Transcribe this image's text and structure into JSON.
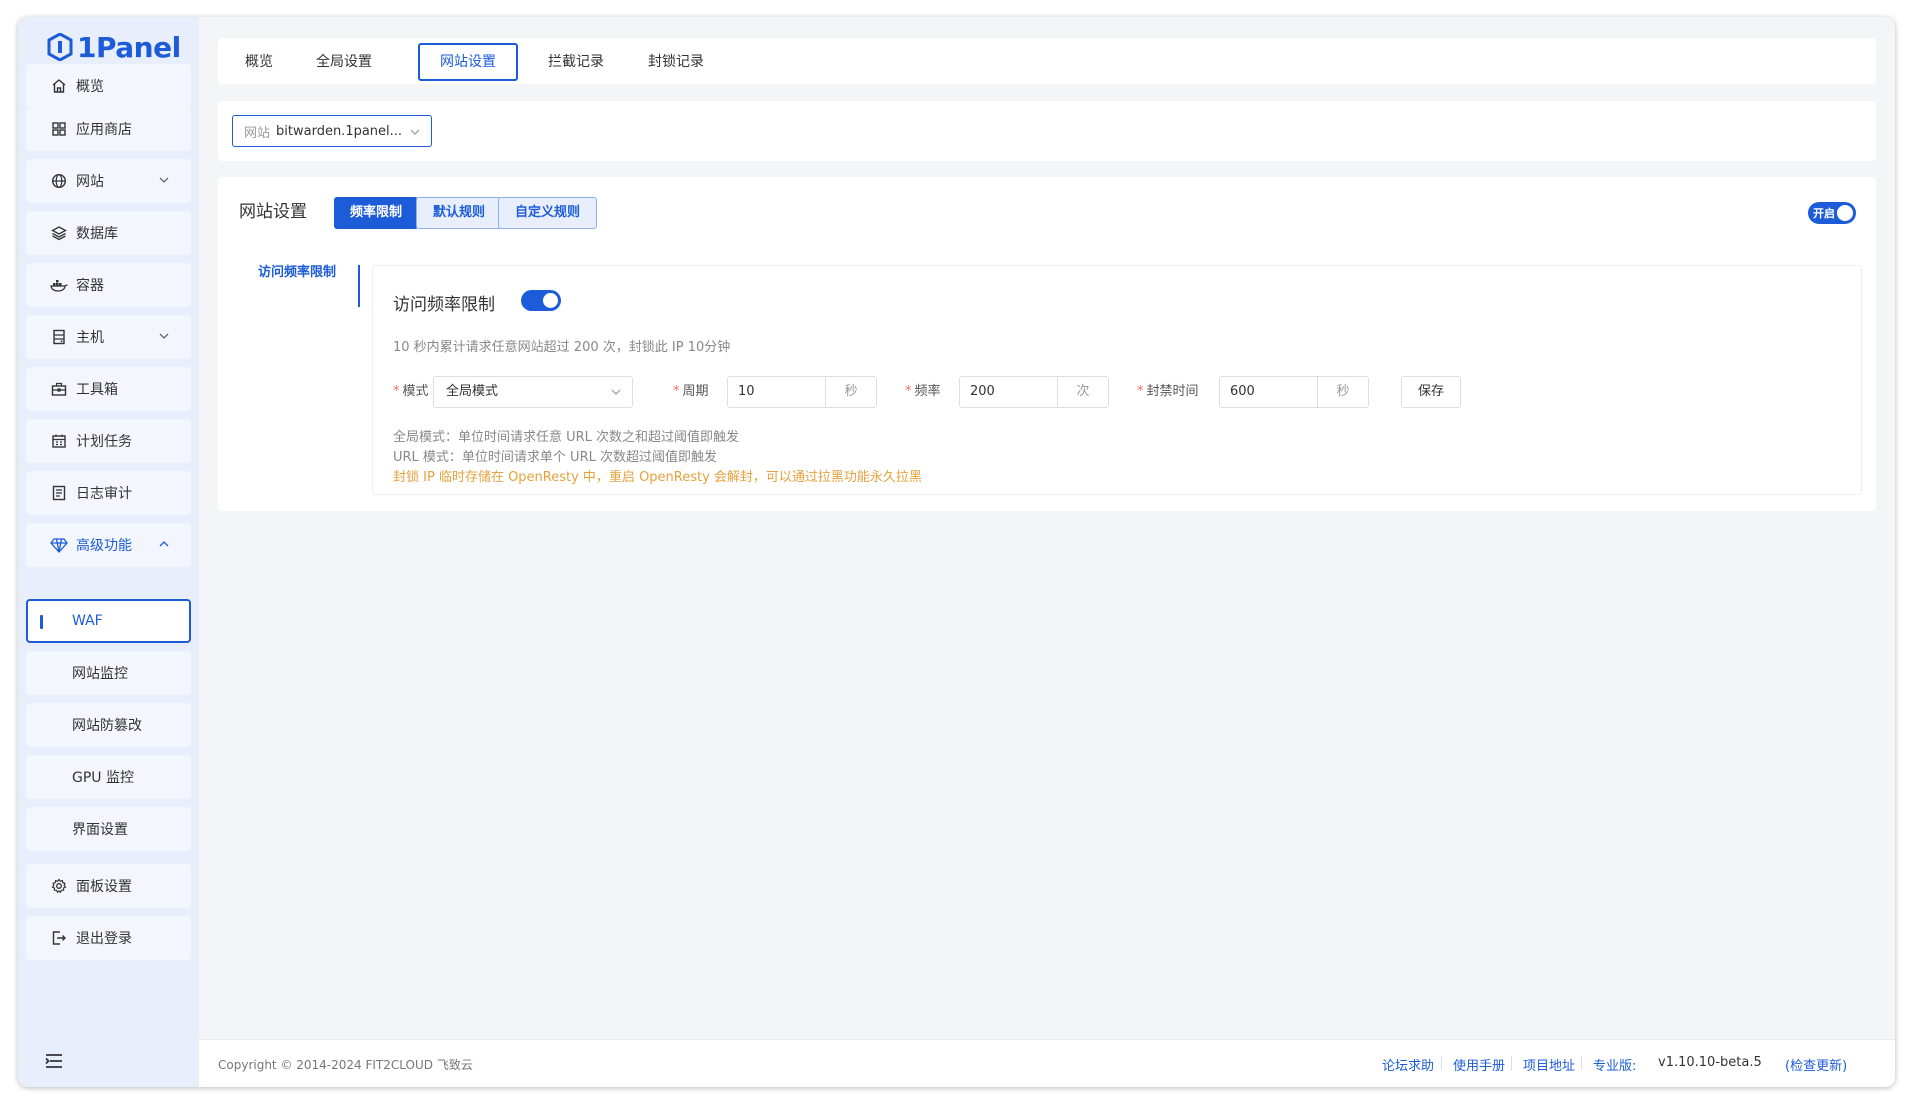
{
  "app": {
    "logo_text": "1Panel"
  },
  "sidebar": {
    "items": [
      {
        "label": "概览",
        "icon": "home-icon"
      },
      {
        "label": "应用商店",
        "icon": "grid-icon"
      },
      {
        "label": "网站",
        "icon": "globe-icon"
      },
      {
        "label": "数据库",
        "icon": "layers-icon"
      },
      {
        "label": "容器",
        "icon": "docker-icon"
      },
      {
        "label": "主机",
        "icon": "server-icon"
      },
      {
        "label": "工具箱",
        "icon": "toolbox-icon"
      },
      {
        "label": "计划任务",
        "icon": "calendar-icon"
      },
      {
        "label": "日志审计",
        "icon": "log-icon"
      },
      {
        "label": "高级功能",
        "icon": "diamond-icon"
      },
      {
        "label": "WAF"
      },
      {
        "label": "网站监控"
      },
      {
        "label": "网站防篡改"
      },
      {
        "label": "GPU 监控"
      },
      {
        "label": "界面设置"
      },
      {
        "label": "面板设置",
        "icon": "gear-icon"
      },
      {
        "label": "退出登录",
        "icon": "logout-icon"
      }
    ]
  },
  "tabs": [
    "概览",
    "全局设置",
    "网站设置",
    "拦截记录",
    "封锁记录"
  ],
  "site_select": {
    "prefix": "网站",
    "value": "bitwarden.1panel..."
  },
  "panel": {
    "title": "网站设置",
    "tabs": [
      "频率限制",
      "默认规则",
      "自定义规则"
    ],
    "enable_label": "开启",
    "side_tab": "访问频率限制",
    "rate_title": "访问频率限制",
    "description": "10 秒内累计请求任意网站超过 200 次，封锁此 IP 10分钟",
    "form": {
      "mode_label": "模式",
      "mode_value": "全局模式",
      "period_label": "周期",
      "period_value": "10",
      "period_unit": "秒",
      "freq_label": "频率",
      "freq_value": "200",
      "freq_unit": "次",
      "ban_label": "封禁时间",
      "ban_value": "600",
      "ban_unit": "秒",
      "save": "保存",
      "required_mark": "*"
    },
    "notes": [
      "全局模式：单位时间请求任意 URL 次数之和超过阈值即触发",
      "URL 模式：单位时间请求单个 URL 次数超过阈值即触发",
      "封锁 IP 临时存储在 OpenResty 中，重启 OpenResty 会解封，可以通过拉黑功能永久拉黑"
    ]
  },
  "footer": {
    "copyright": "Copyright © 2014-2024 FIT2CLOUD 飞致云",
    "links": [
      "论坛求助",
      "使用手册",
      "项目地址"
    ],
    "edition": "专业版:",
    "version": "v1.10.10-beta.5",
    "check_update": "(检查更新)"
  },
  "colors": {
    "primary": "#1c5cd8",
    "warning": "#e6a23c",
    "sidebar_bg": "#e8eefc"
  }
}
